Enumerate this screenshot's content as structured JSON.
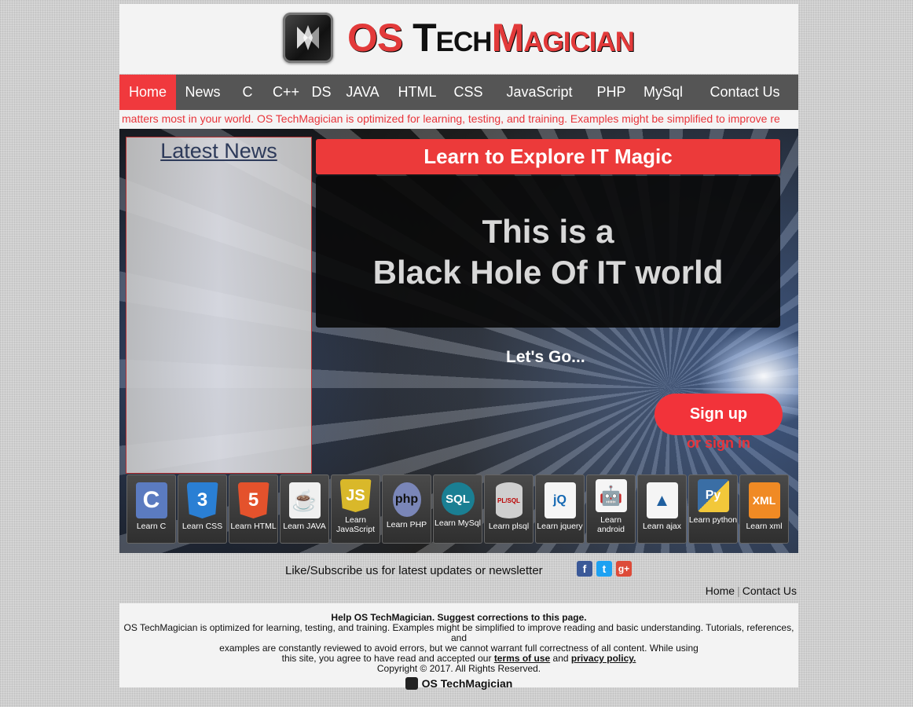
{
  "brand": {
    "os": "OS ",
    "tech": "Tech",
    "magic": "Magician"
  },
  "nav": [
    {
      "label": "Home",
      "active": true
    },
    {
      "label": "News"
    },
    {
      "label": "C"
    },
    {
      "label": "C++"
    },
    {
      "label": "DS"
    },
    {
      "label": "JAVA"
    },
    {
      "label": "HTML"
    },
    {
      "label": "CSS"
    },
    {
      "label": "JavaScript"
    },
    {
      "label": "PHP"
    },
    {
      "label": "MySql"
    },
    {
      "label": "Contact Us"
    }
  ],
  "marquee": "matters most in your world. OS TechMagician is optimized for learning, testing, and training. Examples might be simplified to improve re",
  "news": {
    "title": "Latest News"
  },
  "hero": {
    "banner": "Learn to Explore IT Magic",
    "line1": "This is a",
    "line2": "Black Hole Of IT world",
    "lets_go": "Let's Go...",
    "signup": "Sign up",
    "signin": "or sign in"
  },
  "courses": [
    {
      "label": "Learn C",
      "icon": "c-icon",
      "glyph": "C",
      "color": "#5b7bc0"
    },
    {
      "label": "Learn CSS",
      "icon": "css3-icon",
      "glyph": "3",
      "color": "#2a7fd4"
    },
    {
      "label": "Learn HTML",
      "icon": "html5-icon",
      "glyph": "5",
      "color": "#e4522c"
    },
    {
      "label": "Learn JAVA",
      "icon": "java-icon",
      "glyph": "☕",
      "color": "#f0f0f0"
    },
    {
      "label": "Learn JavaScript",
      "icon": "js-icon",
      "glyph": "JS",
      "color": "#d9b82a"
    },
    {
      "label": "Learn PHP",
      "icon": "php-icon",
      "glyph": "php",
      "color": "#7a86b8"
    },
    {
      "label": "Learn MySql",
      "icon": "sql-icon",
      "glyph": "SQL",
      "color": "#1a7f93"
    },
    {
      "label": "Learn plsql",
      "icon": "plsql-icon",
      "glyph": "PL/SQL",
      "color": "#cfcfcf"
    },
    {
      "label": "Learn jquery",
      "icon": "jquery-icon",
      "glyph": "jQ",
      "color": "#f5f5f5"
    },
    {
      "label": "Learn android",
      "icon": "android-icon",
      "glyph": "🤖",
      "color": "#f5f5f5"
    },
    {
      "label": "Learn ajax",
      "icon": "ajax-icon",
      "glyph": "▲",
      "color": "#f5f5f5"
    },
    {
      "label": "Learn python",
      "icon": "python-icon",
      "glyph": "Py",
      "color": "#3a6ea5"
    },
    {
      "label": "Learn xml",
      "icon": "xml-icon",
      "glyph": "XML",
      "color": "#f08a24"
    }
  ],
  "social": {
    "text": "Like/Subscribe us for latest updates or newsletter",
    "facebook": "f",
    "twitter": "t",
    "google": "g+"
  },
  "footer_links": {
    "home": "Home",
    "sep": "|",
    "contact": "Contact Us"
  },
  "footer": {
    "help": "Help OS TechMagician. Suggest corrections to this page.",
    "line1": "OS TechMagician is optimized for learning, testing, and training. Examples might be simplified to improve reading and basic understanding. Tutorials, references, and",
    "line2": "examples are constantly reviewed to avoid errors, but we cannot warrant full correctness of all content. While using",
    "line3a": "this site, you agree to have read and accepted our",
    "terms": "terms of use",
    "and": "and",
    "privacy": "privacy policy.",
    "copyright": "Copyright © 2017. All Rights Reserved.",
    "logo_text": "OS TechMagician"
  }
}
